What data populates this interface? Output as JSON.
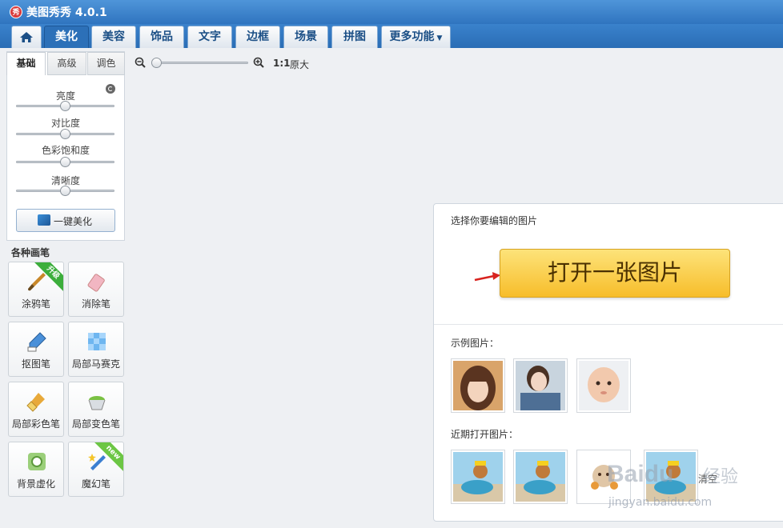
{
  "app": {
    "title": "美图秀秀 4.0.1",
    "logo_text": "秀"
  },
  "nav": {
    "home_icon": "home-icon",
    "tabs": [
      {
        "label": "美化",
        "active": true
      },
      {
        "label": "美容"
      },
      {
        "label": "饰品"
      },
      {
        "label": "文字"
      },
      {
        "label": "边框"
      },
      {
        "label": "场景"
      },
      {
        "label": "拼图"
      }
    ],
    "more_label": "更多功能"
  },
  "adjust": {
    "tabs": [
      "基础",
      "高级",
      "调色"
    ],
    "active_tab": "基础",
    "sliders": [
      {
        "label": "亮度",
        "value": 0.5
      },
      {
        "label": "对比度",
        "value": 0.5
      },
      {
        "label": "色彩饱和度",
        "value": 0.5
      },
      {
        "label": "清晰度",
        "value": 0.5
      }
    ],
    "one_click_label": "一键美化"
  },
  "brushes": {
    "title": "各种画笔",
    "items": [
      {
        "label": "涂鸦笔",
        "badge": "升级",
        "icon": "brush-icon"
      },
      {
        "label": "消除笔",
        "icon": "eraser-icon"
      },
      {
        "label": "抠图笔",
        "icon": "pen-icon"
      },
      {
        "label": "局部马赛克",
        "icon": "mosaic-icon"
      },
      {
        "label": "局部彩色笔",
        "icon": "color-brush-icon"
      },
      {
        "label": "局部变色笔",
        "icon": "paint-bucket-icon"
      },
      {
        "label": "背景虚化",
        "icon": "blur-icon"
      },
      {
        "label": "魔幻笔",
        "badge": "new",
        "icon": "magic-wand-icon"
      }
    ]
  },
  "zoom": {
    "ratio_label": "1:1",
    "original_label": "原大",
    "level": 0.0
  },
  "open": {
    "heading": "选择你要编辑的图片",
    "button_label": "打开一张图片",
    "sample_label": "示例图片：",
    "recent_label": "近期打开图片："
  },
  "watermark": {
    "brand": "Baidu",
    "sub": "经验",
    "url": "jingyan.baidu.com",
    "overlap_text": "清空"
  },
  "colors": {
    "accent": "#2c70b8",
    "open_button": "#f9cd4a",
    "badge_green": "#3cae3c"
  }
}
